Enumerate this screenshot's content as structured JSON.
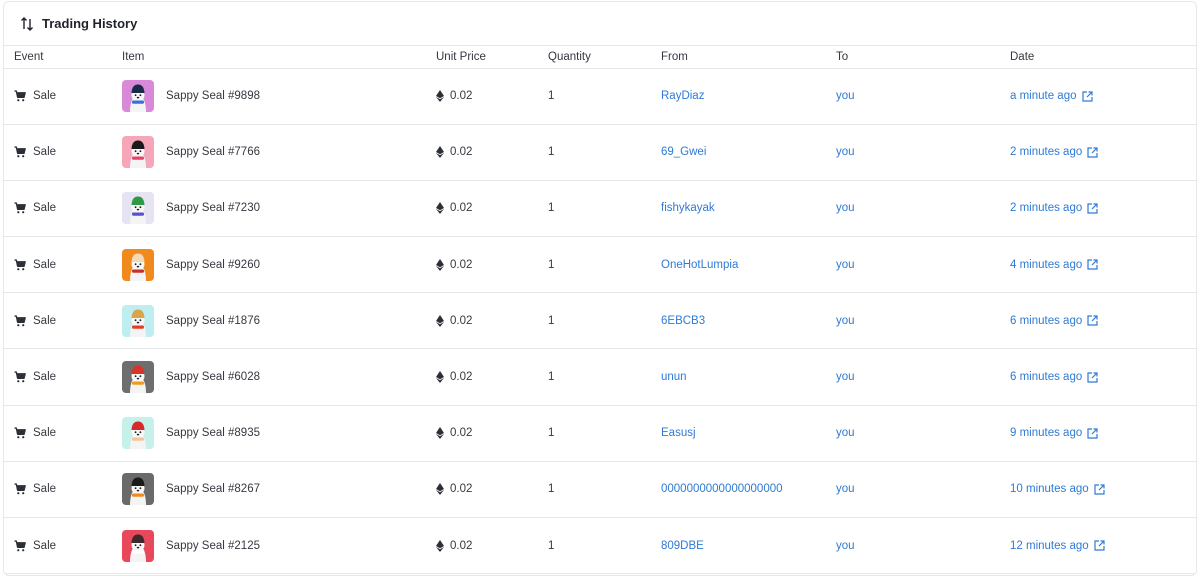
{
  "panel": {
    "title": "Trading History",
    "icon": "sort-arrows-icon"
  },
  "columns": {
    "event": "Event",
    "item": "Item",
    "unit_price": "Unit Price",
    "quantity": "Quantity",
    "from": "From",
    "to": "To",
    "date": "Date"
  },
  "colors": {
    "link": "#2f7ad6",
    "border": "#e5e8eb",
    "text": "#353840"
  },
  "rows": [
    {
      "event": "Sale",
      "item": "Sappy Seal #9898",
      "price": "0.02",
      "quantity": "1",
      "from": "RayDiaz",
      "to": "you",
      "date": "a minute ago",
      "thumb_bg": "#d88ad8",
      "hat": "#1b2a4a",
      "scarf": "#3a6fd8"
    },
    {
      "event": "Sale",
      "item": "Sappy Seal #7766",
      "price": "0.02",
      "quantity": "1",
      "from": "69_Gwei",
      "to": "you",
      "date": "2 minutes ago",
      "thumb_bg": "#f5a6b8",
      "hat": "#1a1a1a",
      "scarf": "#e8436a"
    },
    {
      "event": "Sale",
      "item": "Sappy Seal #7230",
      "price": "0.02",
      "quantity": "1",
      "from": "fishykayak",
      "to": "you",
      "date": "2 minutes ago",
      "thumb_bg": "#e6e3f2",
      "hat": "#2e9b44",
      "scarf": "#5a4fd0"
    },
    {
      "event": "Sale",
      "item": "Sappy Seal #9260",
      "price": "0.02",
      "quantity": "1",
      "from": "OneHotLumpia",
      "to": "you",
      "date": "4 minutes ago",
      "thumb_bg": "#f08a1c",
      "hat": "#f3d9b8",
      "scarf": "#c8302a"
    },
    {
      "event": "Sale",
      "item": "Sappy Seal #1876",
      "price": "0.02",
      "quantity": "1",
      "from": "6EBCB3",
      "to": "you",
      "date": "6 minutes ago",
      "thumb_bg": "#bfeef0",
      "hat": "#d9a44a",
      "scarf": "#e0402a"
    },
    {
      "event": "Sale",
      "item": "Sappy Seal #6028",
      "price": "0.02",
      "quantity": "1",
      "from": "unun",
      "to": "you",
      "date": "6 minutes ago",
      "thumb_bg": "#6e6e6e",
      "hat": "#d8342a",
      "scarf": "#f09a1c"
    },
    {
      "event": "Sale",
      "item": "Sappy Seal #8935",
      "price": "0.02",
      "quantity": "1",
      "from": "Easusj",
      "to": "you",
      "date": "9 minutes ago",
      "thumb_bg": "#c6f0ea",
      "hat": "#d82a2a",
      "scarf": "#f2c59a"
    },
    {
      "event": "Sale",
      "item": "Sappy Seal #8267",
      "price": "0.02",
      "quantity": "1",
      "from": "0000000000000000000",
      "to": "you",
      "date": "10 minutes ago",
      "thumb_bg": "#6a6a6a",
      "hat": "#1a1a1a",
      "scarf": "#f08a1c"
    },
    {
      "event": "Sale",
      "item": "Sappy Seal #2125",
      "price": "0.02",
      "quantity": "1",
      "from": "809DBE",
      "to": "you",
      "date": "12 minutes ago",
      "thumb_bg": "#e8485a",
      "hat": "#3a2a2a",
      "scarf": "#ffffff"
    }
  ]
}
